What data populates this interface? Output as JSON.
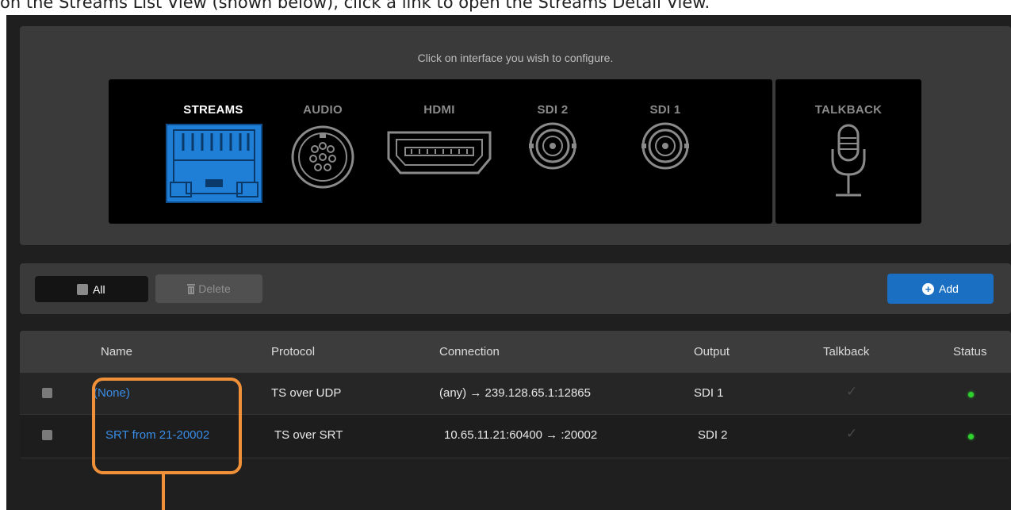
{
  "caption": "on the Streams List View (shown below), click a link to open the Streams Detail View.",
  "interface_panel": {
    "prompt": "Click on interface you wish to configure.",
    "interfaces": [
      {
        "label": "STREAMS",
        "icon": "ethernet-port-icon",
        "active": true
      },
      {
        "label": "AUDIO",
        "icon": "audio-connector-icon",
        "active": false
      },
      {
        "label": "HDMI",
        "icon": "hdmi-port-icon",
        "active": false
      },
      {
        "label": "SDI 2",
        "icon": "bnc-connector-icon",
        "active": false
      },
      {
        "label": "SDI 1",
        "icon": "bnc-connector-icon",
        "active": false
      }
    ],
    "talkback": {
      "label": "TALKBACK",
      "icon": "microphone-icon"
    }
  },
  "toolbar": {
    "select_all_label": "All",
    "delete_label": "Delete",
    "add_label": "Add"
  },
  "table": {
    "columns": [
      "Name",
      "Protocol",
      "Connection",
      "Output",
      "Talkback",
      "Status"
    ],
    "rows": [
      {
        "name": "(None)",
        "protocol": "TS over UDP",
        "connection": "(any) → 239.128.65.1:12865",
        "output": "SDI 1",
        "talkback": "✓",
        "status": "online"
      },
      {
        "name": "SRT from 21-20002",
        "protocol": "TS over SRT",
        "connection": "10.65.11.21:60400 → :20002",
        "output": "SDI 2",
        "talkback": "✓",
        "status": "online"
      }
    ]
  },
  "colors": {
    "accent_blue": "#1a6fc2",
    "link_blue": "#3a8de6",
    "highlight_orange": "#f0913a",
    "status_green": "#2fd12f"
  }
}
